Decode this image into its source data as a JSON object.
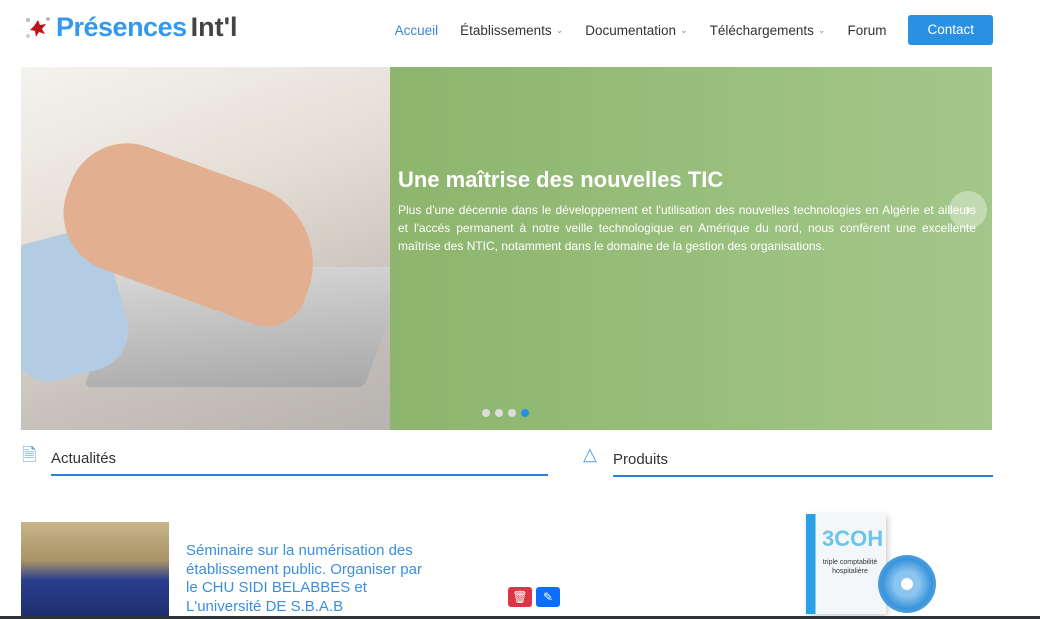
{
  "logo": {
    "part1": "Présences",
    "part2": "Int'l"
  },
  "nav": {
    "items": [
      {
        "label": "Accueil",
        "active": true
      },
      {
        "label": "Établissements",
        "dropdown": true
      },
      {
        "label": "Documentation",
        "dropdown": true
      },
      {
        "label": "Téléchargements",
        "dropdown": true
      },
      {
        "label": "Forum"
      }
    ],
    "contact": "Contact"
  },
  "hero": {
    "title": "Une maîtrise des nouvelles TIC",
    "text": "Plus d'une décennie dans le développement et l'utilisation des nouvelles technologies en Algérie et ailleurs et l'accés permanent à notre veille technologique en Amérique du nord, nous confèrent une excellente maîtrise des NTIC, notamment dans le domaine de la gestion des organisations.",
    "slides": 4,
    "active_slide": 4,
    "next_icon": "chevron-right-icon"
  },
  "sections": {
    "news": "Actualités",
    "products": "Produits"
  },
  "news_item": {
    "title": "Séminaire sur la numérisation des établissement public. Organiser par le CHU SIDI BELABBES et L'université DE S.B.A.B"
  },
  "product": {
    "name": "3COH",
    "subtitle": "triple comptabilité hospitalière"
  },
  "colors": {
    "accent": "#2a90e2",
    "delete": "#dc3545",
    "edit": "#0d6efd"
  }
}
